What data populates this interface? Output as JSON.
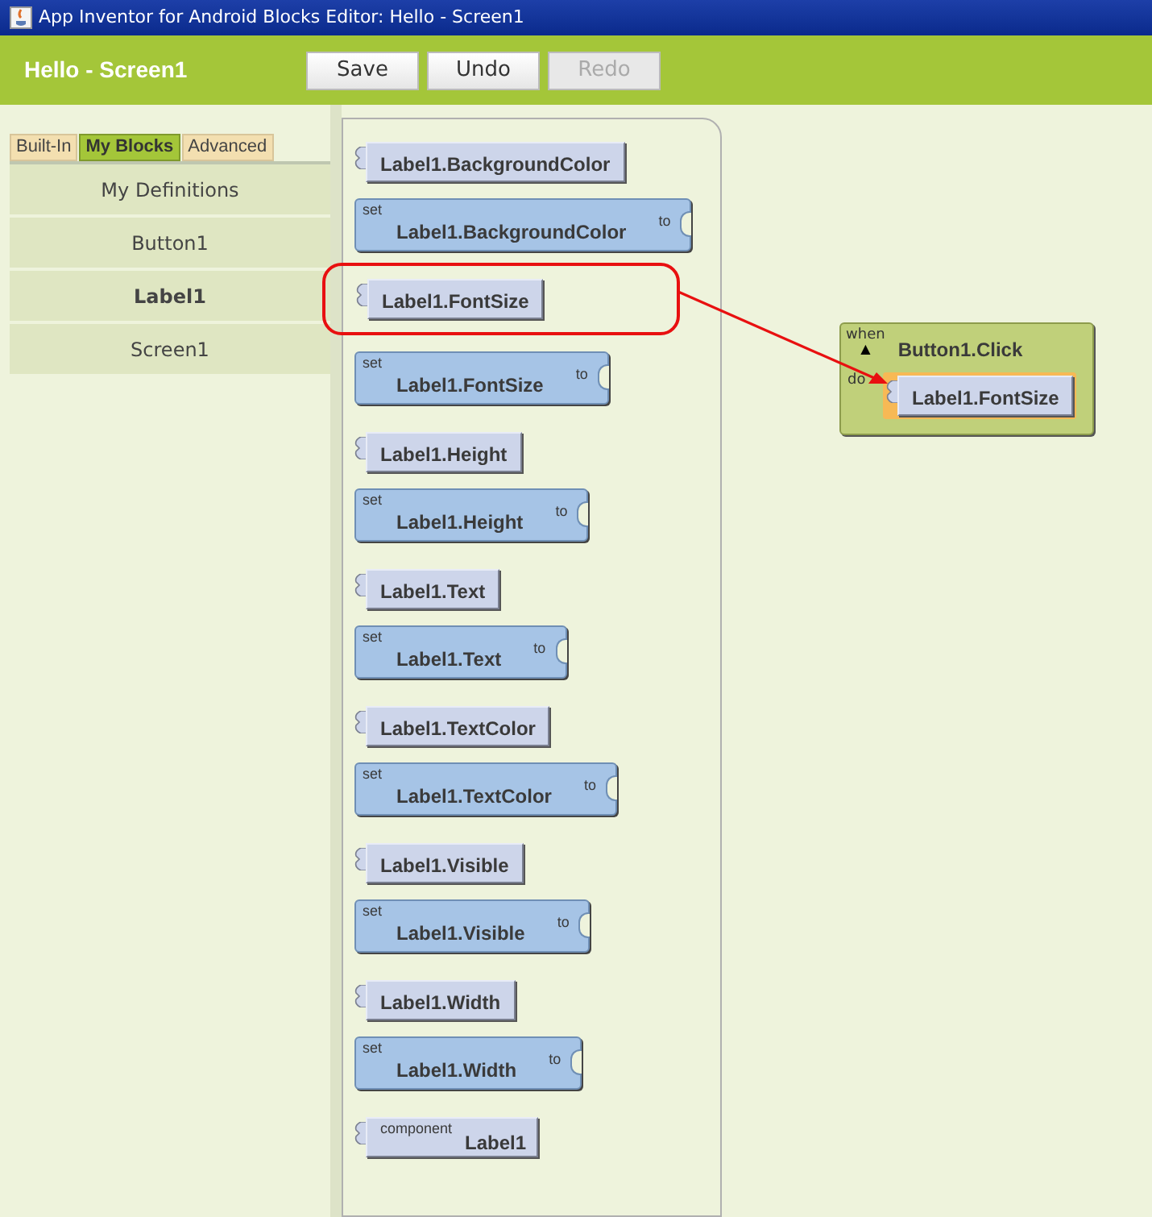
{
  "window": {
    "title": "App Inventor for Android Blocks Editor: Hello - Screen1"
  },
  "toolbar": {
    "title": "Hello - Screen1",
    "buttons": [
      {
        "label": "Save",
        "disabled": false
      },
      {
        "label": "Undo",
        "disabled": false
      },
      {
        "label": "Redo",
        "disabled": true
      }
    ]
  },
  "tabs": [
    {
      "label": "Built-In",
      "selected": false
    },
    {
      "label": "My Blocks",
      "selected": true
    },
    {
      "label": "Advanced",
      "selected": false
    }
  ],
  "drawers": [
    {
      "label": "My Definitions",
      "selected": false
    },
    {
      "label": "Button1",
      "selected": false
    },
    {
      "label": "Label1",
      "selected": true
    },
    {
      "label": "Screen1",
      "selected": false
    }
  ],
  "blocks": [
    {
      "kind": "getter",
      "label": "Label1.BackgroundColor",
      "highlighted": false
    },
    {
      "kind": "setter",
      "prefix": "set",
      "label": "Label1.BackgroundColor",
      "suffix": "to",
      "highlighted": false
    },
    {
      "kind": "getter",
      "label": "Label1.FontSize",
      "highlighted": true
    },
    {
      "kind": "setter",
      "prefix": "set",
      "label": "Label1.FontSize",
      "suffix": "to",
      "highlighted": false
    },
    {
      "kind": "getter",
      "label": "Label1.Height",
      "highlighted": false
    },
    {
      "kind": "setter",
      "prefix": "set",
      "label": "Label1.Height",
      "suffix": "to",
      "highlighted": false
    },
    {
      "kind": "getter",
      "label": "Label1.Text",
      "highlighted": false
    },
    {
      "kind": "setter",
      "prefix": "set",
      "label": "Label1.Text",
      "suffix": "to",
      "highlighted": false
    },
    {
      "kind": "getter",
      "label": "Label1.TextColor",
      "highlighted": false
    },
    {
      "kind": "setter",
      "prefix": "set",
      "label": "Label1.TextColor",
      "suffix": "to",
      "highlighted": false
    },
    {
      "kind": "getter",
      "label": "Label1.Visible",
      "highlighted": false
    },
    {
      "kind": "setter",
      "prefix": "set",
      "label": "Label1.Visible",
      "suffix": "to",
      "highlighted": false
    },
    {
      "kind": "getter",
      "label": "Label1.Width",
      "highlighted": false
    },
    {
      "kind": "setter",
      "prefix": "set",
      "label": "Label1.Width",
      "suffix": "to",
      "highlighted": false
    },
    {
      "kind": "component",
      "prefix": "component",
      "label": "Label1",
      "highlighted": false
    }
  ],
  "canvas": {
    "event": {
      "prefix": "when",
      "label": "Button1.Click",
      "slot": "do",
      "collapsed_marker": "▲",
      "body": {
        "label": "Label1.FontSize",
        "selected": true
      }
    }
  }
}
